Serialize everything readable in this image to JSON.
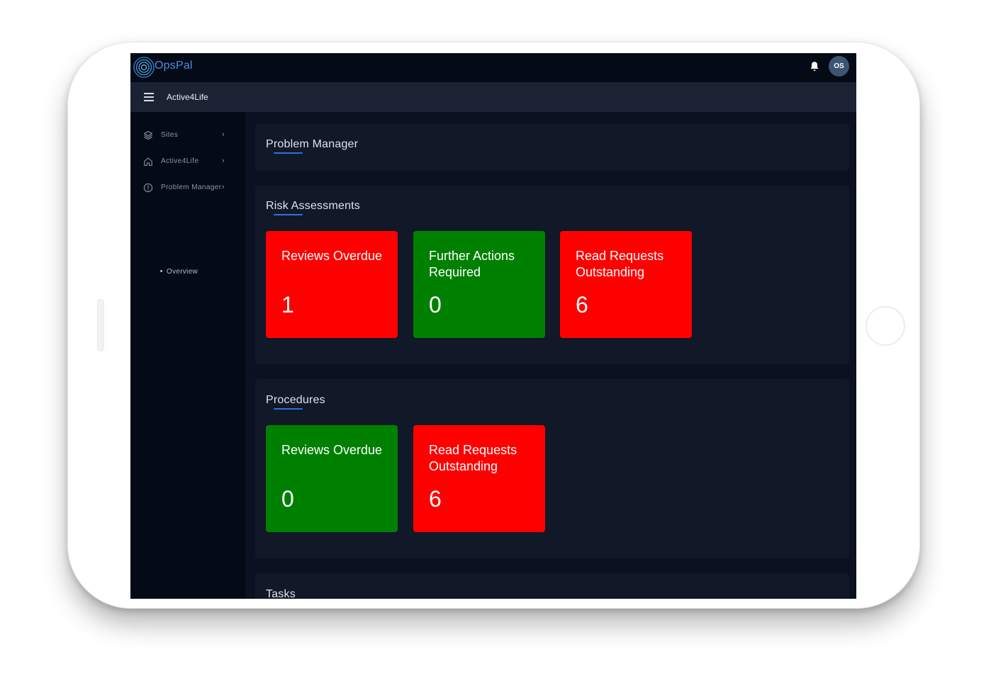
{
  "app": {
    "name": "OpsPal",
    "brand_color": "#4f8bdc"
  },
  "header": {
    "avatar_initials": "OS",
    "org_name": "Active4Life"
  },
  "sidebar": {
    "items": [
      {
        "label": "Sites",
        "icon": "layers-icon"
      },
      {
        "label": "Active4Life",
        "icon": "home-icon"
      },
      {
        "label": "Problem Manager",
        "icon": "alert-circle-icon"
      }
    ],
    "sub_items": [
      {
        "label": "Overview"
      }
    ]
  },
  "page": {
    "title": "Problem Manager"
  },
  "sections": [
    {
      "title": "Risk Assessments",
      "tiles": [
        {
          "label": "Reviews Overdue",
          "value": "1",
          "status": "red"
        },
        {
          "label": "Further Actions Required",
          "value": "0",
          "status": "green"
        },
        {
          "label": "Read Requests Outstanding",
          "value": "6",
          "status": "red"
        }
      ]
    },
    {
      "title": "Procedures",
      "tiles": [
        {
          "label": "Reviews Overdue",
          "value": "0",
          "status": "green"
        },
        {
          "label": "Read Requests Outstanding",
          "value": "6",
          "status": "red"
        }
      ]
    },
    {
      "title": "Tasks",
      "tiles": []
    }
  ],
  "colors": {
    "alert": "#ff0000",
    "ok": "#008000",
    "accent": "#2f6fe0"
  }
}
